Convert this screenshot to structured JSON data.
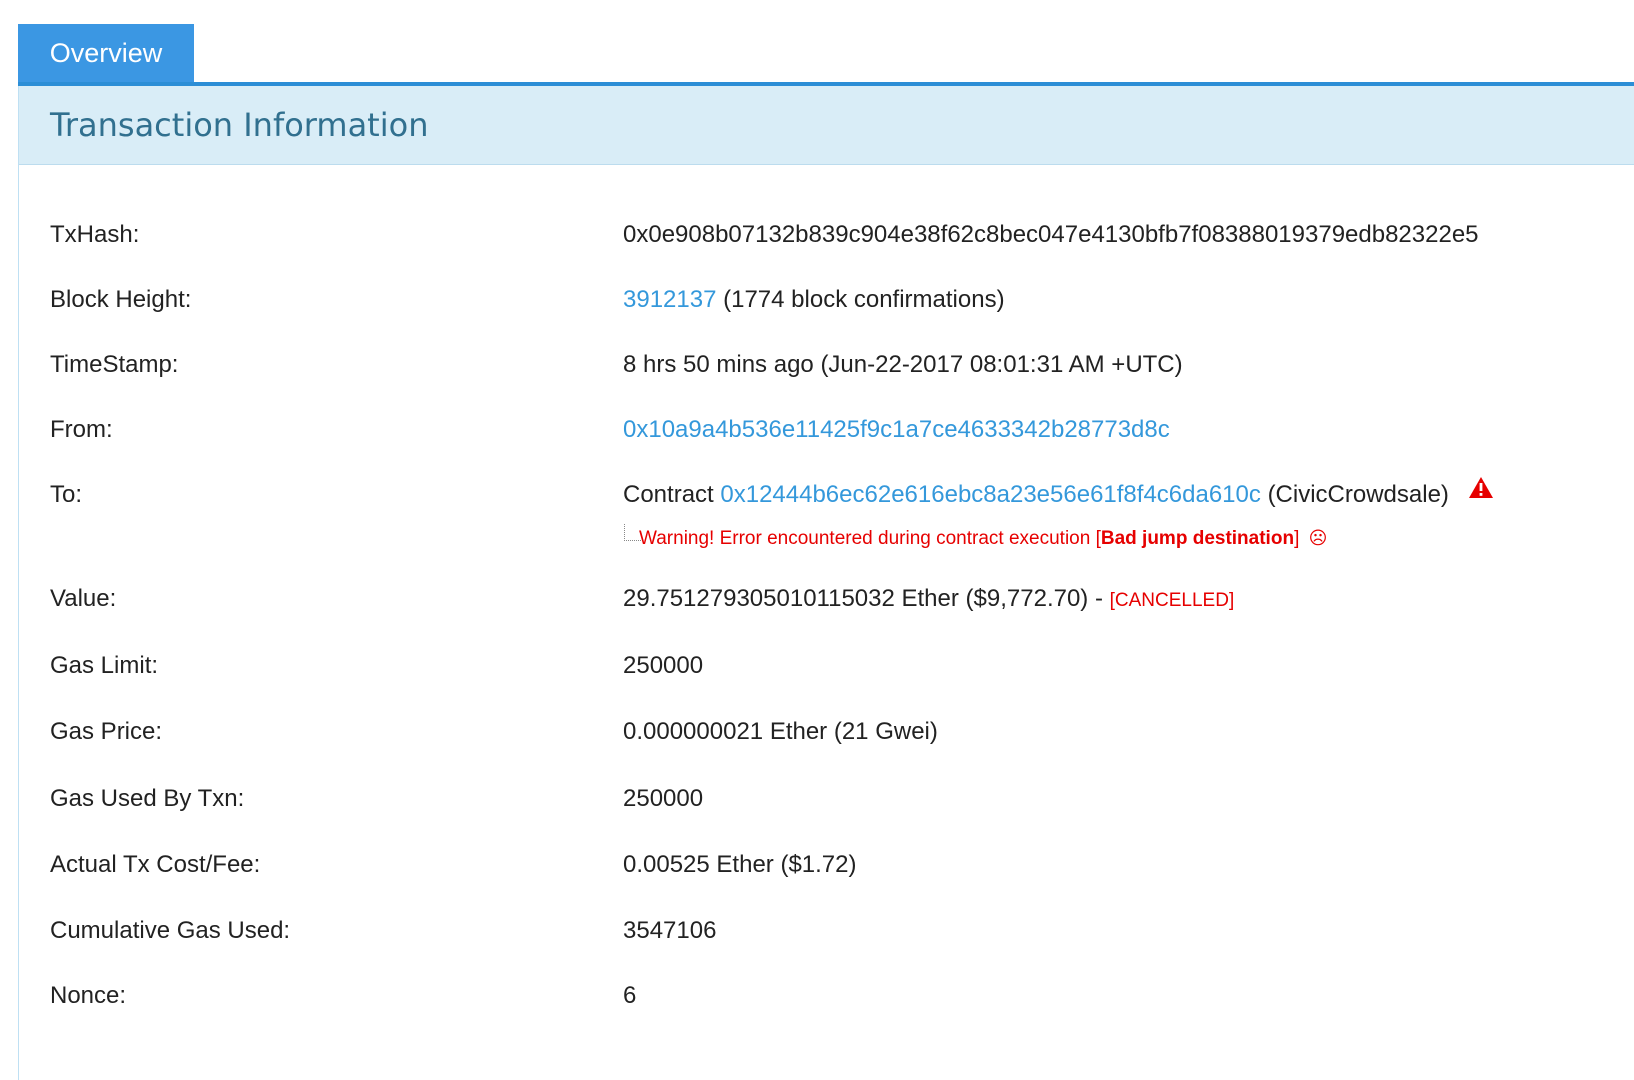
{
  "tabs": {
    "overview_label": "Overview"
  },
  "panel": {
    "title": "Transaction Information"
  },
  "rows": {
    "txhash": {
      "label": "TxHash:",
      "value": "0x0e908b07132b839c904e38f62c8bec047e4130bfb7f08388019379edb82322e5"
    },
    "block_height": {
      "label": "Block Height:",
      "block": "3912137",
      "confirmations": "(1774 block confirmations)"
    },
    "timestamp": {
      "label": "TimeStamp:",
      "value": "8 hrs 50 mins ago (Jun-22-2017 08:01:31 AM +UTC)"
    },
    "from": {
      "label": "From:",
      "address": "0x10a9a4b536e11425f9c1a7ce4633342b28773d8c"
    },
    "to": {
      "label": "To:",
      "prefix": "Contract",
      "address": "0x12444b6ec62e616ebc8a23e56e61f8f4c6da610c",
      "name": "(CivicCrowdsale)",
      "warning_icon": "warning-triangle-icon",
      "warning_text": "Warning! Error encountered during contract execution [",
      "error_text": "Bad jump destination",
      "warning_close": "]",
      "sad_icon": "sad-face-icon"
    },
    "value": {
      "label": "Value:",
      "amount": "29.751279305010115032 Ether ($9,772.70) - ",
      "status": "[CANCELLED]"
    },
    "gas_limit": {
      "label": "Gas Limit:",
      "value": "250000"
    },
    "gas_price": {
      "label": "Gas Price:",
      "value": "0.000000021 Ether (21 Gwei)"
    },
    "gas_used": {
      "label": "Gas Used By Txn:",
      "value": "250000"
    },
    "tx_fee": {
      "label": "Actual Tx Cost/Fee:",
      "value": "0.00525 Ether ($1.72)"
    },
    "cumulative_gas": {
      "label": "Cumulative Gas Used:",
      "value": "3547106"
    },
    "nonce": {
      "label": "Nonce:",
      "value": "6"
    }
  },
  "colors": {
    "accent": "#3b97e3",
    "link": "#3498db",
    "heading_bg": "#d9edf7",
    "heading_text": "#31708f",
    "error": "#e60000"
  }
}
